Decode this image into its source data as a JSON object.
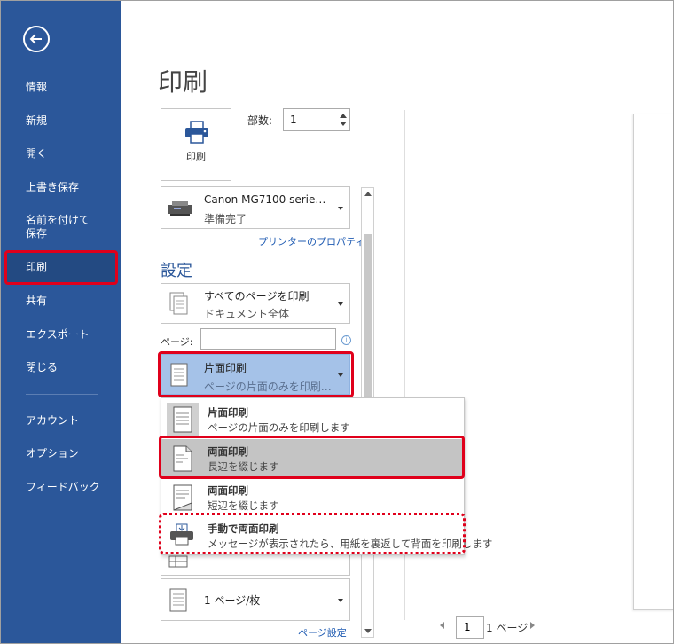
{
  "sidebar": {
    "items": [
      {
        "label": "情報"
      },
      {
        "label": "新規"
      },
      {
        "label": "開く"
      },
      {
        "label": "上書き保存"
      },
      {
        "label": "名前を付けて\n保存"
      },
      {
        "label": "印刷"
      },
      {
        "label": "共有"
      },
      {
        "label": "エクスポート"
      },
      {
        "label": "閉じる"
      },
      {
        "label": "アカウント"
      },
      {
        "label": "オプション"
      },
      {
        "label": "フィードバック"
      }
    ]
  },
  "main": {
    "title": "印刷",
    "print_button": "印刷",
    "copies_label": "部数:",
    "copies_value": "1",
    "printer": {
      "name": "Canon MG7100 serie…",
      "status": "準備完了",
      "properties_link": "プリンターのプロパティ"
    },
    "settings_title": "設定",
    "pages_dropdown": {
      "title": "すべてのページを印刷",
      "subtitle": "ドキュメント全体"
    },
    "pages_label": "ページ:",
    "pages_value": "",
    "duplex_dropdown": {
      "title": "片面印刷",
      "subtitle": "ページの片面のみを印刷…"
    },
    "per_sheet_dropdown": {
      "title": "1 ページ/枚"
    },
    "page_setup_link": "ページ設定",
    "pager": {
      "current": "1",
      "total": "1 ページ"
    }
  },
  "duplex_options": [
    {
      "title": "片面印刷",
      "subtitle": "ページの片面のみを印刷します"
    },
    {
      "title": "両面印刷",
      "subtitle": "長辺を綴じます"
    },
    {
      "title": "両面印刷",
      "subtitle": "短辺を綴じます"
    },
    {
      "title": "手動で両面印刷",
      "subtitle": "メッセージが表示されたら、用紙を裏返して背面を印刷します"
    }
  ],
  "colors": {
    "sidebar": "#2b579a",
    "highlight": "#e0001b",
    "accent": "#2b579a"
  }
}
